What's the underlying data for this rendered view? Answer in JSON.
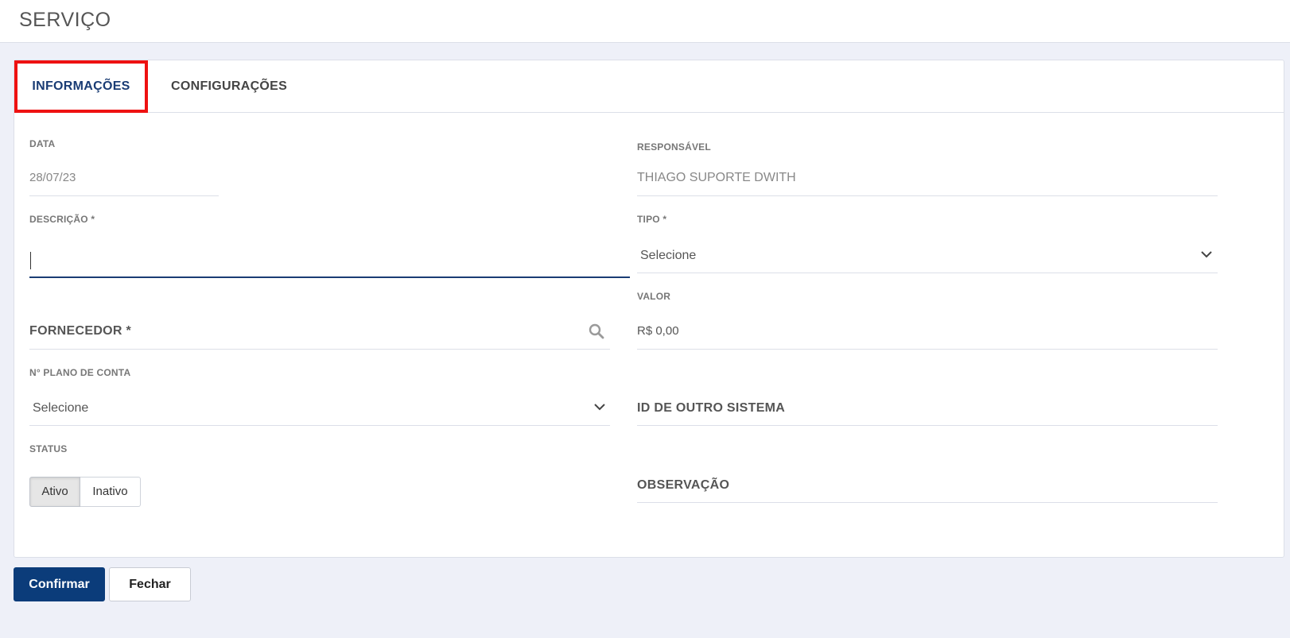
{
  "header": {
    "title": "SERVIÇO"
  },
  "tabs": [
    {
      "label": "INFORMAÇÕES",
      "active": true
    },
    {
      "label": "CONFIGURAÇÕES",
      "active": false
    }
  ],
  "form": {
    "data": {
      "label": "DATA",
      "value": "28/07/23"
    },
    "responsavel": {
      "label": "RESPONSÁVEL",
      "value": "THIAGO SUPORTE DWITH"
    },
    "descricao": {
      "label": "DESCRIÇÃO *",
      "value": ""
    },
    "tipo": {
      "label": "TIPO *",
      "value": "Selecione"
    },
    "valor": {
      "label": "VALOR",
      "value": "R$ 0,00"
    },
    "fornecedor": {
      "label": "FORNECEDOR *"
    },
    "plano_conta": {
      "label": "N° PLANO DE CONTA",
      "value": "Selecione"
    },
    "id_outro_sistema": {
      "label": "ID DE OUTRO SISTEMA"
    },
    "status": {
      "label": "STATUS",
      "options": [
        "Ativo",
        "Inativo"
      ],
      "selected": "Ativo"
    },
    "observacao": {
      "label": "OBSERVAÇÃO"
    }
  },
  "actions": {
    "confirm_label": "Confirmar",
    "close_label": "Fechar"
  },
  "colors": {
    "primary": "#0b3c7a",
    "highlight": "#ee1111",
    "background": "#eef0f8"
  },
  "icons": {
    "search": "search-icon",
    "chevron": "chevron-down-icon"
  }
}
